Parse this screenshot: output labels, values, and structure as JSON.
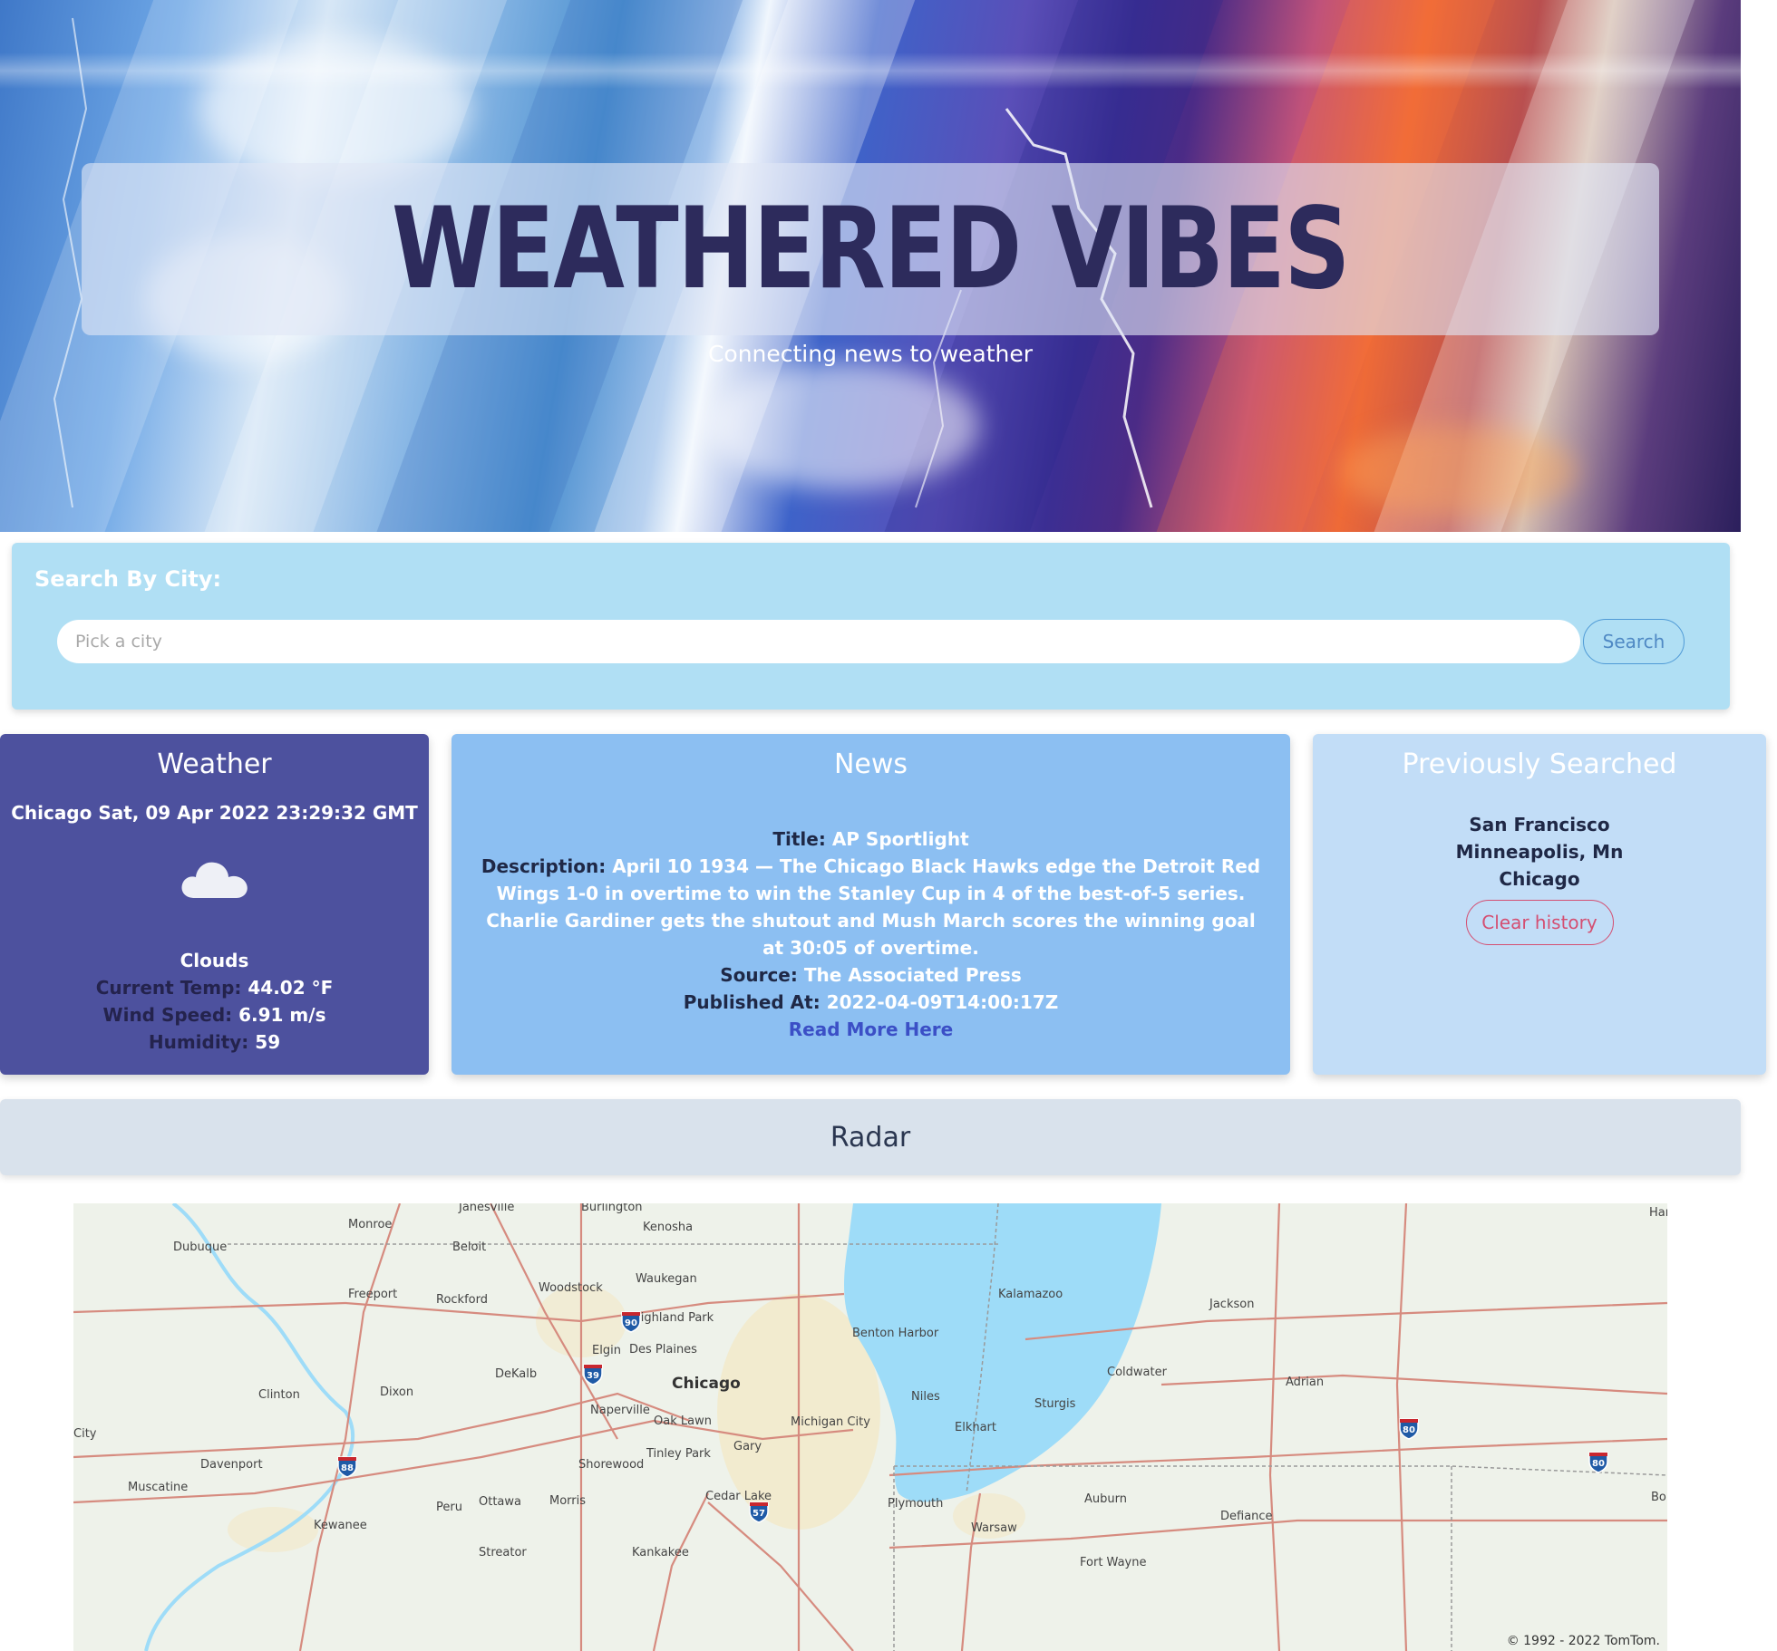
{
  "hero": {
    "title": "WEATHERED VIBES",
    "subtitle": "Connecting news to weather"
  },
  "search": {
    "label": "Search By City:",
    "placeholder": "Pick a city",
    "button_label": "Search"
  },
  "weather": {
    "heading": "Weather",
    "city_date": "Chicago Sat, 09 Apr 2022 23:29:32 GMT",
    "icon": "cloud-icon",
    "condition": "Clouds",
    "temp_label": "Current Temp:",
    "temp_value": "44.02 °F",
    "wind_label": "Wind Speed:",
    "wind_value": "6.91 m/s",
    "humidity_label": "Humidity:",
    "humidity_value": "59"
  },
  "news": {
    "heading": "News",
    "title_label": "Title:",
    "title_value": "AP Sportlight",
    "description_label": "Description:",
    "description_value": "April 10 1934 — The Chicago Black Hawks edge the Detroit Red Wings 1-0 in overtime to win the Stanley Cup in 4 of the best-of-5 series. Charlie Gardiner gets the shutout and Mush March scores the winning goal at 30:05 of overtime.",
    "source_label": "Source:",
    "source_value": "The Associated Press",
    "published_label": "Published At:",
    "published_value": "2022-04-09T14:00:17Z",
    "read_more": "Read More Here"
  },
  "previous": {
    "heading": "Previously Searched",
    "cities": [
      "San Francisco",
      "Minneapolis, Mn",
      "Chicago"
    ],
    "clear_label": "Clear history"
  },
  "radar": {
    "heading": "Radar",
    "copyright": "© 1992 - 2022 TomTom.",
    "places": [
      "Janesville",
      "Burlington",
      "Har",
      "Monroe",
      "Kenosha",
      "Dubuque",
      "Beloit",
      "Waukegan",
      "Woodstock",
      "Freeport",
      "Rockford",
      "Kalamazoo",
      "Jackson",
      "Highland Park",
      "Benton Harbor",
      "Elgin",
      "Des Plaines",
      "DeKalb",
      "Coldwater",
      "Chicago",
      "Adrian",
      "Clinton",
      "Dixon",
      "Niles",
      "Sturgis",
      "Naperville",
      "City",
      "Oak Lawn",
      "Michigan City",
      "Elkhart",
      "Gary",
      "Tinley Park",
      "Davenport",
      "Shorewood",
      "Muscatine",
      "Cedar Lake",
      "Auburn",
      "Bo",
      "Peru",
      "Ottawa",
      "Morris",
      "Plymouth",
      "Defiance",
      "Kewanee",
      "Warsaw",
      "Streator",
      "Kankakee",
      "Fort Wayne"
    ],
    "highways": [
      "90",
      "39",
      "88",
      "57",
      "80",
      "80"
    ],
    "colors": {
      "land": "#eef2ea",
      "lake": "#9edcf8",
      "road": "#d68b7f",
      "urban": "#f3e8c6"
    }
  }
}
